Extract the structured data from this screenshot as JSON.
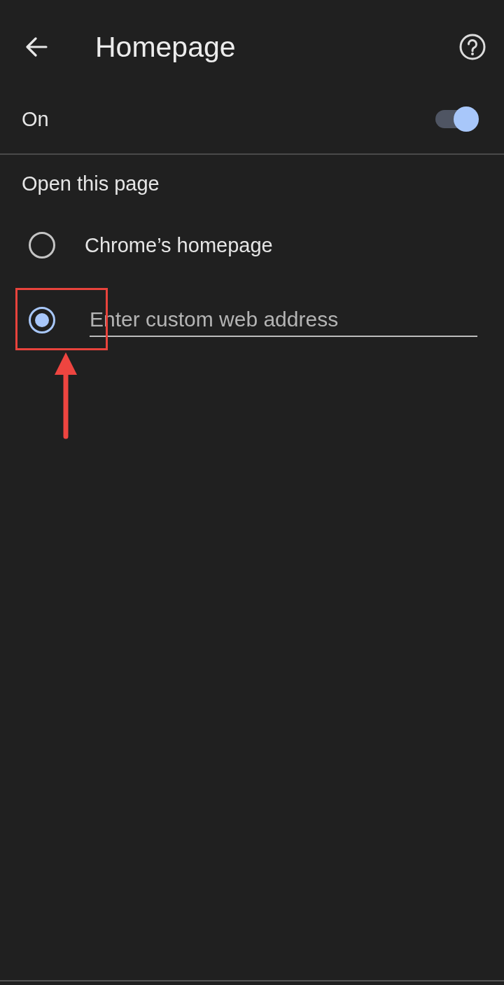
{
  "header": {
    "title": "Homepage"
  },
  "switch_row": {
    "label": "On",
    "on": true
  },
  "section": {
    "title": "Open this page"
  },
  "options": [
    {
      "kind": "radio",
      "label": "Chrome’s homepage",
      "selected": false
    },
    {
      "kind": "input",
      "placeholder": "Enter custom web address",
      "selected": true
    }
  ],
  "annotations": [
    {
      "kind": "box"
    },
    {
      "kind": "arrow"
    }
  ]
}
